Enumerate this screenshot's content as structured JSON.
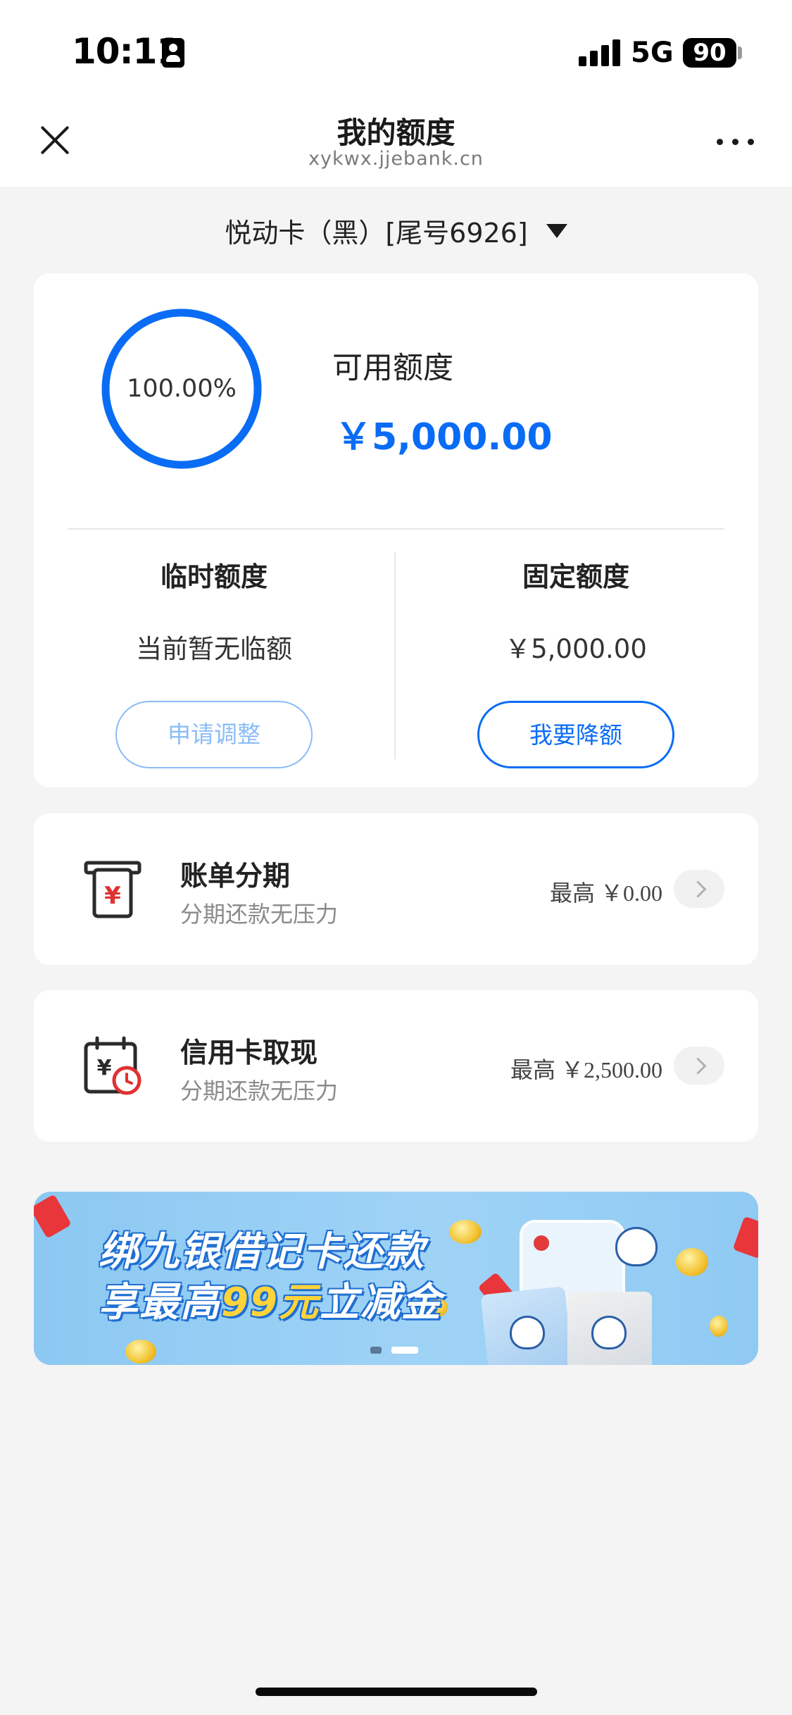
{
  "status_bar": {
    "time": "10:11",
    "network": "5G",
    "battery": "90"
  },
  "nav": {
    "title": "我的额度",
    "subtitle": "xykwx.jjebank.cn"
  },
  "card_selector": {
    "label": "悦动卡（黑）[尾号6926]"
  },
  "limit_summary": {
    "ring_percent_label": "100.00%",
    "ring_fraction": 1.0,
    "available_label": "可用额度",
    "available_value": "￥5,000.00",
    "accent_color": "#0a6cf5"
  },
  "temporary_limit": {
    "title": "临时额度",
    "value": "当前暂无临额",
    "button_label": "申请调整",
    "button_enabled": false
  },
  "fixed_limit": {
    "title": "固定额度",
    "value": "￥5,000.00",
    "button_label": "我要降额",
    "button_enabled": true
  },
  "services": [
    {
      "icon": "atm-bill-icon",
      "title": "账单分期",
      "subtitle": "分期还款无压力",
      "amount_label": "最高",
      "amount_value": "￥0.00"
    },
    {
      "icon": "calendar-cash-icon",
      "title": "信用卡取现",
      "subtitle": "分期还款无压力",
      "amount_label": "最高",
      "amount_value": "￥2,500.00"
    }
  ],
  "banner": {
    "line1": "绑九银借记卡还款",
    "line2_prefix": "享最高",
    "line2_highlight": "99元",
    "line2_suffix": "立减金",
    "slide_count": 2,
    "active_slide": 2
  }
}
